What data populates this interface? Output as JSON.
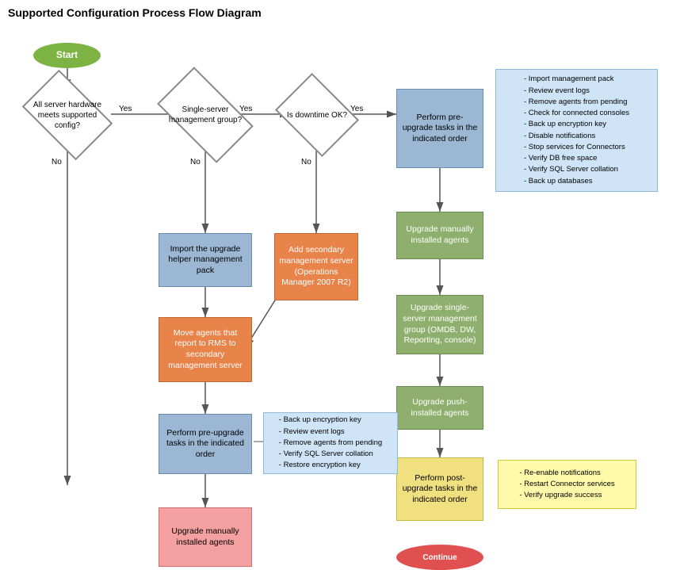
{
  "title": "Supported Configuration Process Flow Diagram",
  "shapes": {
    "start": {
      "label": "Start"
    },
    "diamond1": {
      "label": "All server hardware meets supported config?"
    },
    "diamond2": {
      "label": "Single-server management group?"
    },
    "diamond3": {
      "label": "Is downtime OK?"
    },
    "perform_pre_right": {
      "label": "Perform pre-upgrade tasks in the indicated order"
    },
    "upgrade_manually_right": {
      "label": "Upgrade manually installed agents"
    },
    "upgrade_single": {
      "label": "Upgrade single-server management group (OMDB, DW, Reporting, console)"
    },
    "upgrade_push": {
      "label": "Upgrade push-installed agents"
    },
    "perform_post": {
      "label": "Perform post-upgrade tasks in the indicated order"
    },
    "import_pack": {
      "label": "Import the upgrade helper management pack"
    },
    "add_secondary": {
      "label": "Add secondary management server (Operations Manager 2007 R2)"
    },
    "move_agents": {
      "label": "Move agents that report to RMS to secondary management server"
    },
    "perform_pre_left": {
      "label": "Perform pre-upgrade tasks in the indicated order"
    },
    "upgrade_manually_left": {
      "label": "Upgrade manually installed agents"
    },
    "callout_right": {
      "lines": [
        "- Import management pack",
        "- Review event logs",
        "- Remove agents from pending",
        "- Check for connected consoles",
        "- Back up encryption key",
        "- Disable notifications",
        "- Stop services for Connectors",
        "- Verify DB free space",
        "- Verify SQL Server collation",
        "- Back up databases"
      ]
    },
    "callout_left": {
      "lines": [
        "- Back up encryption key",
        "- Review event logs",
        "- Remove agents from pending",
        "- Verify SQL Server collation",
        "- Restore encryption key"
      ]
    },
    "callout_post": {
      "lines": [
        "- Re-enable notifications",
        "- Restart Connector services",
        "- Verify upgrade success"
      ]
    }
  },
  "labels": {
    "yes": "Yes",
    "no": "No"
  }
}
